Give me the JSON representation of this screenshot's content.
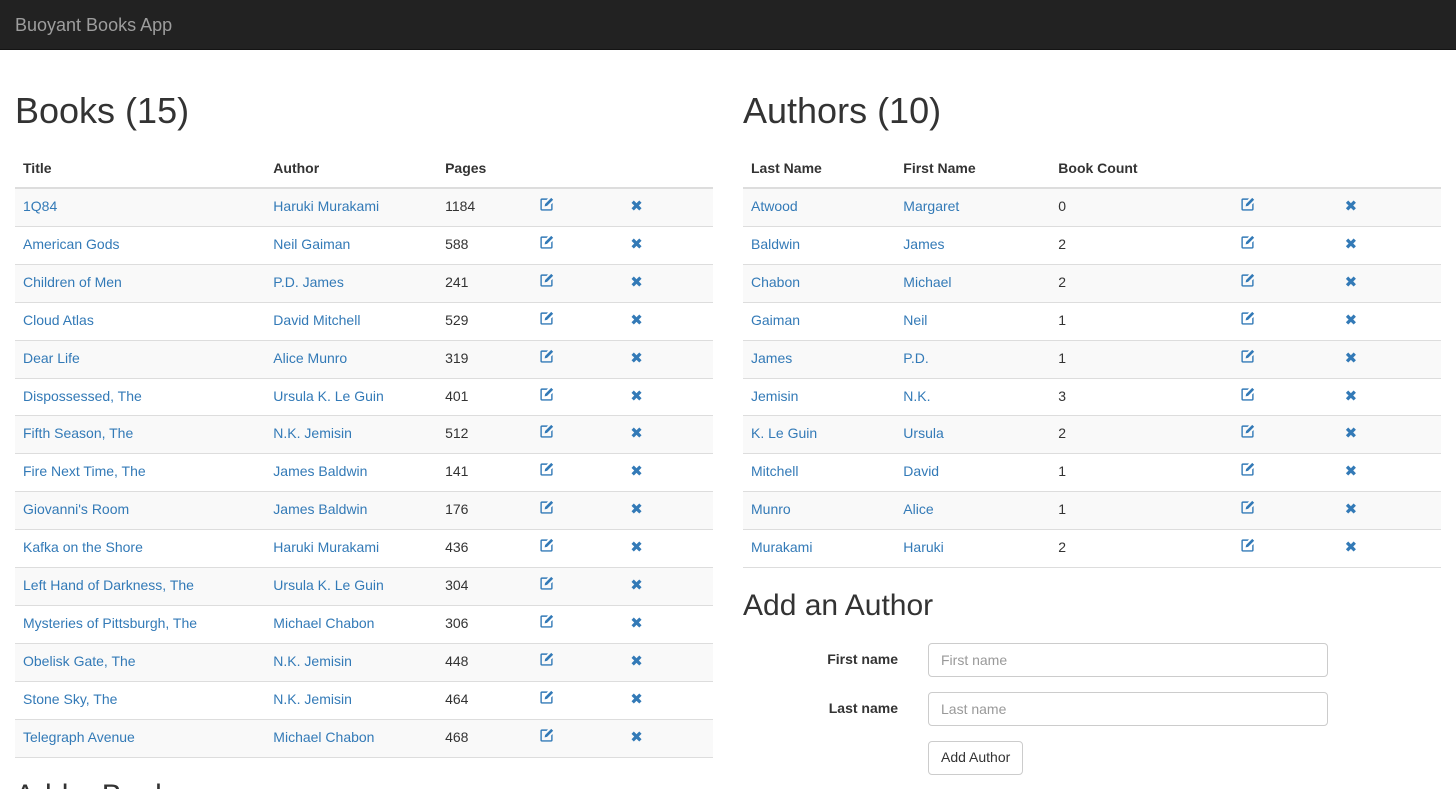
{
  "navbar": {
    "brand": "Buoyant Books App"
  },
  "books_panel": {
    "heading": "Books (15)",
    "columns": [
      "Title",
      "Author",
      "Pages",
      "",
      ""
    ],
    "edit_icon": "pencil-square-icon",
    "delete_icon": "remove-icon",
    "delete_glyph": "✖",
    "rows": [
      {
        "title": "1Q84",
        "author": "Haruki Murakami",
        "pages": "1184"
      },
      {
        "title": "American Gods",
        "author": "Neil Gaiman",
        "pages": "588"
      },
      {
        "title": "Children of Men",
        "author": "P.D. James",
        "pages": "241"
      },
      {
        "title": "Cloud Atlas",
        "author": "David Mitchell",
        "pages": "529"
      },
      {
        "title": "Dear Life",
        "author": "Alice Munro",
        "pages": "319"
      },
      {
        "title": "Dispossessed, The",
        "author": "Ursula K. Le Guin",
        "pages": "401"
      },
      {
        "title": "Fifth Season, The",
        "author": "N.K. Jemisin",
        "pages": "512"
      },
      {
        "title": "Fire Next Time, The",
        "author": "James Baldwin",
        "pages": "141"
      },
      {
        "title": "Giovanni's Room",
        "author": "James Baldwin",
        "pages": "176"
      },
      {
        "title": "Kafka on the Shore",
        "author": "Haruki Murakami",
        "pages": "436"
      },
      {
        "title": "Left Hand of Darkness, The",
        "author": "Ursula K. Le Guin",
        "pages": "304"
      },
      {
        "title": "Mysteries of Pittsburgh, The",
        "author": "Michael Chabon",
        "pages": "306"
      },
      {
        "title": "Obelisk Gate, The",
        "author": "N.K. Jemisin",
        "pages": "448"
      },
      {
        "title": "Stone Sky, The",
        "author": "N.K. Jemisin",
        "pages": "464"
      },
      {
        "title": "Telegraph Avenue",
        "author": "Michael Chabon",
        "pages": "468"
      }
    ],
    "next_section_heading": "Add a Book"
  },
  "authors_panel": {
    "heading": "Authors (10)",
    "columns": [
      "Last Name",
      "First Name",
      "Book Count",
      "",
      ""
    ],
    "edit_icon": "pencil-square-icon",
    "delete_icon": "remove-icon",
    "delete_glyph": "✖",
    "rows": [
      {
        "last": "Atwood",
        "first": "Margaret",
        "count": "0"
      },
      {
        "last": "Baldwin",
        "first": "James",
        "count": "2"
      },
      {
        "last": "Chabon",
        "first": "Michael",
        "count": "2"
      },
      {
        "last": "Gaiman",
        "first": "Neil",
        "count": "1"
      },
      {
        "last": "James",
        "first": "P.D.",
        "count": "1"
      },
      {
        "last": "Jemisin",
        "first": "N.K.",
        "count": "3"
      },
      {
        "last": "K. Le Guin",
        "first": "Ursula",
        "count": "2"
      },
      {
        "last": "Mitchell",
        "first": "David",
        "count": "1"
      },
      {
        "last": "Munro",
        "first": "Alice",
        "count": "1"
      },
      {
        "last": "Murakami",
        "first": "Haruki",
        "count": "2"
      }
    ]
  },
  "add_author_form": {
    "heading": "Add an Author",
    "first_name_label": "First name",
    "first_name_value": "",
    "first_name_placeholder": "First name",
    "last_name_label": "Last name",
    "last_name_value": "",
    "last_name_placeholder": "Last name",
    "submit_label": "Add Author"
  },
  "colors": {
    "navbar_bg": "#222222",
    "navbar_text": "#9d9d9d",
    "link": "#337ab7",
    "text": "#333333",
    "stripe": "#f9f9f9",
    "border": "#dddddd",
    "placeholder": "#999999"
  }
}
